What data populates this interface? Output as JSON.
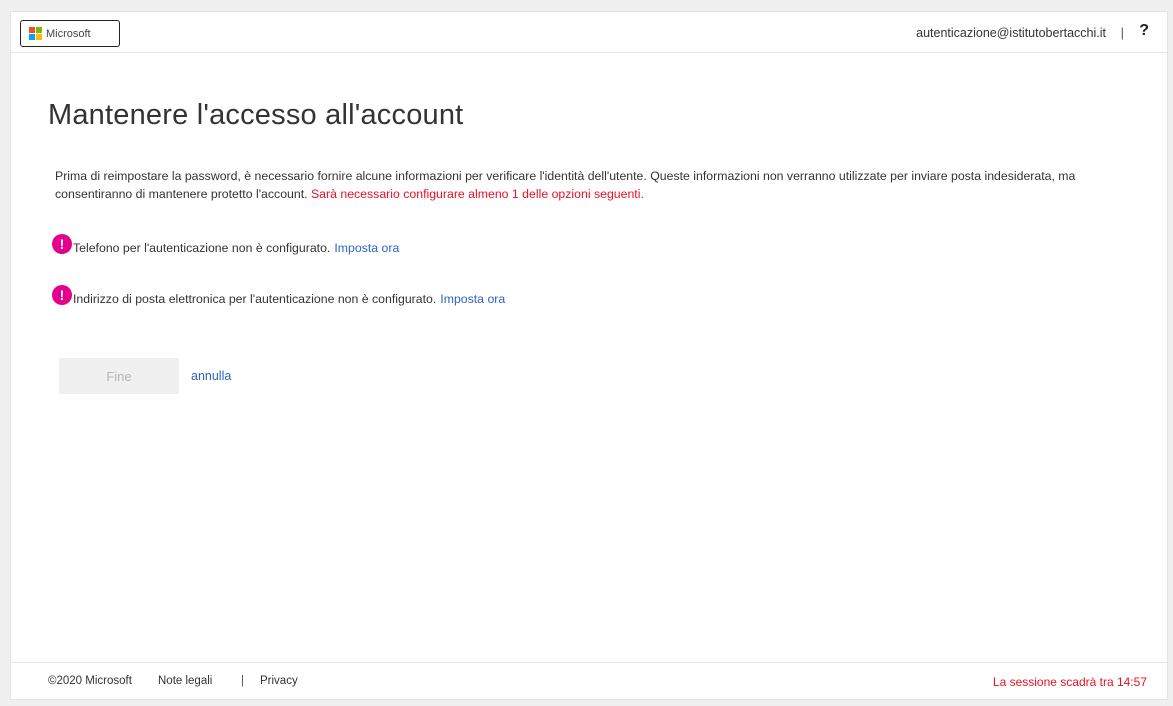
{
  "header": {
    "logo_text": "Microsoft",
    "logo_colors": [
      "#f25022",
      "#7fba00",
      "#00a4ef",
      "#ffb900"
    ],
    "user_email": "autenticazione@istitutobertacchi.it",
    "separator": "|",
    "help_label": "?"
  },
  "main": {
    "title": "Mantenere l'accesso all'account",
    "intro_text": "Prima di reimpostare la password, è necessario fornire alcune informazioni per verificare l'identità dell'utente. Queste informazioni non verranno utilizzate per inviare posta indesiderata, ma consentiranno di mantenere protetto l'account.",
    "intro_warning": "Sarà necessario configurare almeno 1 delle opzioni seguenti.",
    "items": [
      {
        "icon": "exclamation-circle-icon",
        "text": "Telefono per l'autenticazione non è configurato.",
        "link": "Imposta ora"
      },
      {
        "icon": "exclamation-circle-icon",
        "text": "Indirizzo di posta elettronica per l'autenticazione non è configurato.",
        "link": "Imposta ora"
      }
    ],
    "finish_button": "Fine",
    "cancel_link": "annulla"
  },
  "footer": {
    "copyright": "©2020 Microsoft",
    "legal_link": "Note legali",
    "separator": "|",
    "privacy_link": "Privacy",
    "session_text": "La sessione scadrà tra 14:57"
  },
  "colors": {
    "warning": "#e81123",
    "link": "#2f63c3",
    "alert_icon": "#e3008c"
  }
}
